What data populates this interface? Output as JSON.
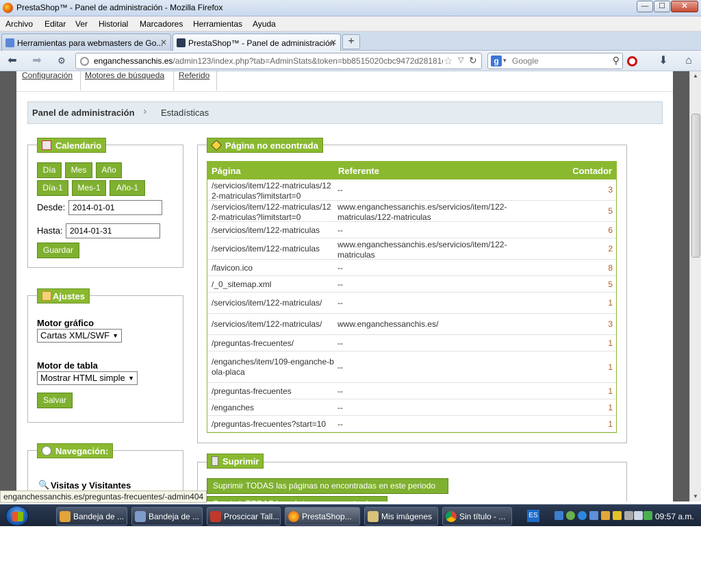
{
  "window": {
    "title": "PrestaShop™ - Panel de administración - Mozilla Firefox",
    "min": "—",
    "max": "☐",
    "close": "✕"
  },
  "menu": [
    "Archivo",
    "Editar",
    "Ver",
    "Historial",
    "Marcadores",
    "Herramientas",
    "Ayuda"
  ],
  "tabs": [
    {
      "label": "Herramientas para webmasters de Go...",
      "close": "✕"
    },
    {
      "label": "PrestaShop™ - Panel de administración",
      "close": "✕"
    }
  ],
  "newtab": "+",
  "nav": {
    "back": "⬅",
    "forward": "➡",
    "url_domain": "enganchessanchis.es",
    "url_rest": "/admin123/index.php?tab=AdminStats&token=bb8515020cbc9472d28181d",
    "star": "☆",
    "dropdown": "▽",
    "reload": "↻",
    "search_engine": "g",
    "search_dropdown": "▾",
    "search_placeholder": "Google",
    "search_icon": "⚲",
    "download": "⬇",
    "home": "⌂"
  },
  "subnav": [
    "Configuración",
    "Motores de búsqueda",
    "Referido"
  ],
  "breadcrumb": {
    "home": "Panel de administración",
    "chevron": "›",
    "current": "Estadísticas"
  },
  "calendar": {
    "legend": "Calendario",
    "buttons_row1": [
      "Día",
      "Mes",
      "Año"
    ],
    "buttons_row2": [
      "Día-1",
      "Mes-1",
      "Año-1"
    ],
    "from_label": "Desde:",
    "from_value": "2014-01-01",
    "to_label": "Hasta:",
    "to_value": "2014-01-31",
    "save": "Guardar"
  },
  "settings": {
    "legend": "Ajustes",
    "graph_engine_label": "Motor gráfico",
    "graph_engine_value": "Cartas XML/SWF",
    "table_engine_label": "Motor de tabla",
    "table_engine_value": "Mostrar HTML simple",
    "save": "Salvar"
  },
  "navigation": {
    "legend": "Navegación:",
    "first_item": "Visitas y Visitantes"
  },
  "notfound": {
    "legend": "Página no encontrada",
    "columns": [
      "Página",
      "Referente",
      "Contador"
    ],
    "rows": [
      {
        "page": "/servicios/item/122-matriculas/122-matriculas?limitstart=0",
        "ref": "--",
        "count": "3"
      },
      {
        "page": "/servicios/item/122-matriculas/122-matriculas?limitstart=0",
        "ref": "www.enganchessanchis.es/servicios/item/122-matriculas/122-matriculas",
        "count": "5"
      },
      {
        "page": "/servicios/item/122-matriculas",
        "ref": "--",
        "count": "6"
      },
      {
        "page": "/servicios/item/122-matriculas",
        "ref": "www.enganchessanchis.es/servicios/item/122-matriculas",
        "count": "2"
      },
      {
        "page": "/favicon.ico",
        "ref": "--",
        "count": "8"
      },
      {
        "page": "/_0_sitemap.xml",
        "ref": "--",
        "count": "5"
      },
      {
        "page": "/servicios/item/122-matriculas/",
        "ref": "--",
        "count": "1"
      },
      {
        "page": "/servicios/item/122-matriculas/",
        "ref": "www.enganchessanchis.es/",
        "count": "3"
      },
      {
        "page": "/preguntas-frecuentes/",
        "ref": "--",
        "count": "1"
      },
      {
        "page": "/enganches/item/109-enganche-bola-placa",
        "ref": "--",
        "count": "1"
      },
      {
        "page": "/preguntas-frecuentes",
        "ref": "--",
        "count": "1"
      },
      {
        "page": "/enganches",
        "ref": "--",
        "count": "1"
      },
      {
        "page": "/preguntas-frecuentes?start=10",
        "ref": "--",
        "count": "1"
      }
    ]
  },
  "delete": {
    "legend": "Suprimir",
    "button_all": "Suprimir TODAS las páginas no encontradas en este periodo",
    "button_partial": "Suprimir TODAS las páginas no encontradas"
  },
  "statusbar": "enganchessanchis.es/preguntas-frecuentes/-admin404",
  "taskbar": {
    "tasks": [
      "Bandeja de ...",
      "Bandeja de ...",
      "Proscicar Tall...",
      "PrestaShop...",
      "Mis imágenes",
      "Sin título - ..."
    ],
    "lang": "ES",
    "clock": "09:57 a.m."
  },
  "colors": {
    "accent_green": "#8ab930",
    "count_color": "#b25c1c"
  }
}
